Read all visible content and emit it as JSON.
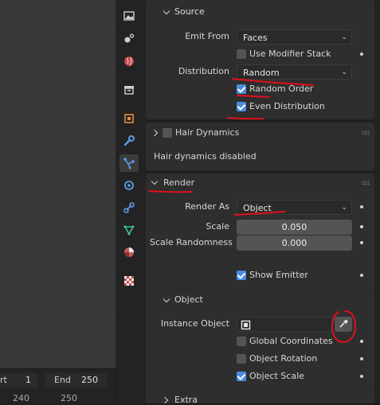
{
  "timeline": {
    "start_label": "rt",
    "start_value": "1",
    "end_label": "End",
    "end_value": "250",
    "marker_a": "240",
    "marker_b": "250"
  },
  "tabs": [
    "image-icon",
    "texture-paint-icon",
    "world-icon",
    "collection-icon",
    "object-icon",
    "wrench-icon",
    "particles-icon",
    "physics-icon",
    "constraints-icon",
    "object-data-icon",
    "material-icon",
    "texture-icon"
  ],
  "source": {
    "header": "Source",
    "emit_from_label": "Emit From",
    "emit_from_value": "Faces",
    "use_modifier_stack": "Use Modifier Stack",
    "distribution_label": "Distribution",
    "distribution_value": "Random",
    "random_order": "Random Order",
    "even_distribution": "Even Distribution"
  },
  "hair_dynamics": {
    "header": "Hair Dynamics",
    "status": "Hair dynamics disabled"
  },
  "render": {
    "header": "Render",
    "render_as_label": "Render As",
    "render_as_value": "Object",
    "scale_label": "Scale",
    "scale_value": "0.050",
    "scale_randomness_label": "Scale Randomness",
    "scale_randomness_value": "0.000",
    "show_emitter": "Show Emitter"
  },
  "object": {
    "header": "Object",
    "instance_object_label": "Instance Object",
    "global_coordinates": "Global Coordinates",
    "object_rotation": "Object Rotation",
    "object_scale": "Object Scale"
  },
  "extra": {
    "header": "Extra"
  },
  "colors": {
    "accent": "#4a8de0",
    "annotation": "#e0101a"
  }
}
